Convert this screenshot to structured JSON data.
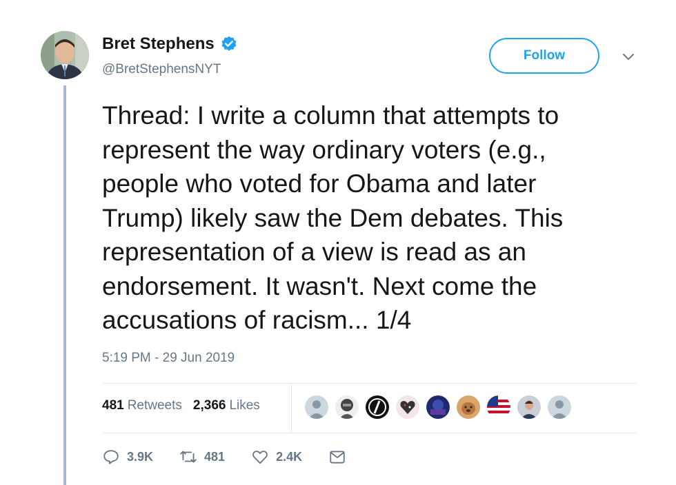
{
  "user": {
    "name": "Bret Stephens",
    "handle": "@BretStephensNYT",
    "verified_icon": "verified-badge-icon",
    "verified_color": "#1da1f2"
  },
  "follow_button": {
    "label": "Follow",
    "color": "#1da1f2"
  },
  "menu_icon": "chevron-down-icon",
  "tweet": {
    "text": "Thread: I write a column that attempts to\nrepresent the way ordinary voters (e.g.,\npeople who voted for Obama and later\nTrump) likely saw the Dem debates. This\nrepresentation of a view is read as an\nendorsement. It wasn't. Next come the\naccusations of racism... 1/4",
    "timestamp": "5:19 PM - 29 Jun 2019"
  },
  "stats": {
    "retweets_count": "481",
    "retweets_label": "Retweets",
    "likes_count": "2,366",
    "likes_label": "Likes"
  },
  "liker_avatars": [
    "default-avatar",
    "helmet-avatar",
    "slash-logo-avatar",
    "heart-avatar",
    "blue-pattern-avatar",
    "dog-avatar",
    "us-flag-avatar",
    "man-avatar",
    "default-avatar"
  ],
  "actions": {
    "reply": {
      "icon": "reply-icon",
      "count": "3.9K"
    },
    "retweet": {
      "icon": "retweet-icon",
      "count": "481"
    },
    "like": {
      "icon": "heart-icon",
      "count": "2.4K"
    },
    "message": {
      "icon": "envelope-icon"
    }
  },
  "colors": {
    "text": "#14171a",
    "secondary": "#657786",
    "thread_line": "#a7b7d8",
    "divider": "#e1e8ed"
  }
}
